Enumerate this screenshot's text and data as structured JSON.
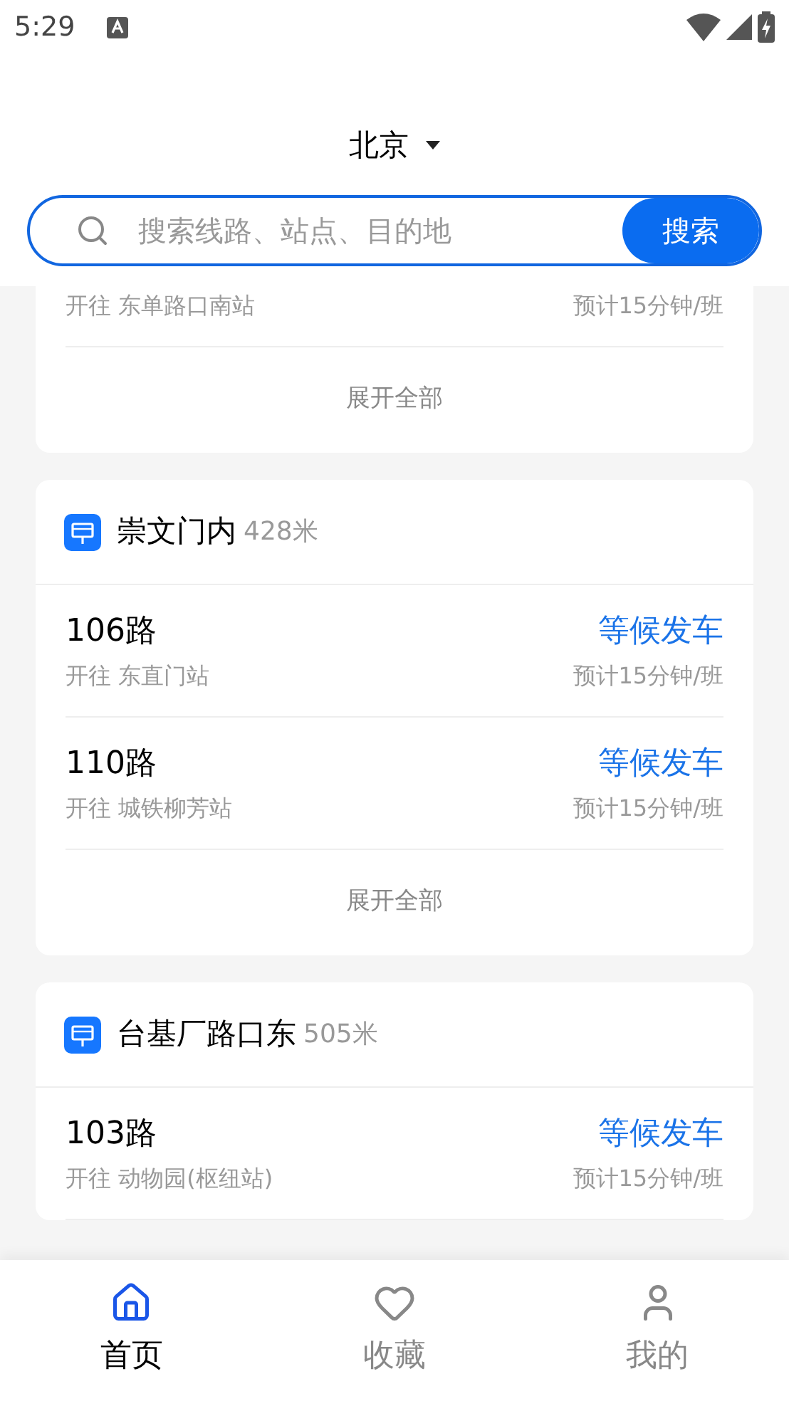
{
  "status_bar": {
    "time": "5:29"
  },
  "header": {
    "city": "北京"
  },
  "search": {
    "placeholder": "搜索线路、站点、目的地",
    "button": "搜索"
  },
  "stations": [
    {
      "partial": true,
      "lines": [
        {
          "direction": "开往 东单路口南站",
          "frequency": "预计15分钟/班"
        }
      ],
      "expand": "展开全部"
    },
    {
      "partial": false,
      "name": "崇文门内",
      "distance": "428米",
      "lines": [
        {
          "name": "106路",
          "status": "等候发车",
          "direction": "开往 东直门站",
          "frequency": "预计15分钟/班"
        },
        {
          "name": "110路",
          "status": "等候发车",
          "direction": "开往 城铁柳芳站",
          "frequency": "预计15分钟/班"
        }
      ],
      "expand": "展开全部"
    },
    {
      "partial": false,
      "name": "台基厂路口东",
      "distance": "505米",
      "lines": [
        {
          "name": "103路",
          "status": "等候发车",
          "direction": "开往 动物园(枢纽站)",
          "frequency": "预计15分钟/班"
        }
      ]
    }
  ],
  "tabs": [
    {
      "label": "首页",
      "kind": "home",
      "selected": true
    },
    {
      "label": "收藏",
      "kind": "heart",
      "selected": false
    },
    {
      "label": "我的",
      "kind": "user",
      "selected": false
    }
  ]
}
